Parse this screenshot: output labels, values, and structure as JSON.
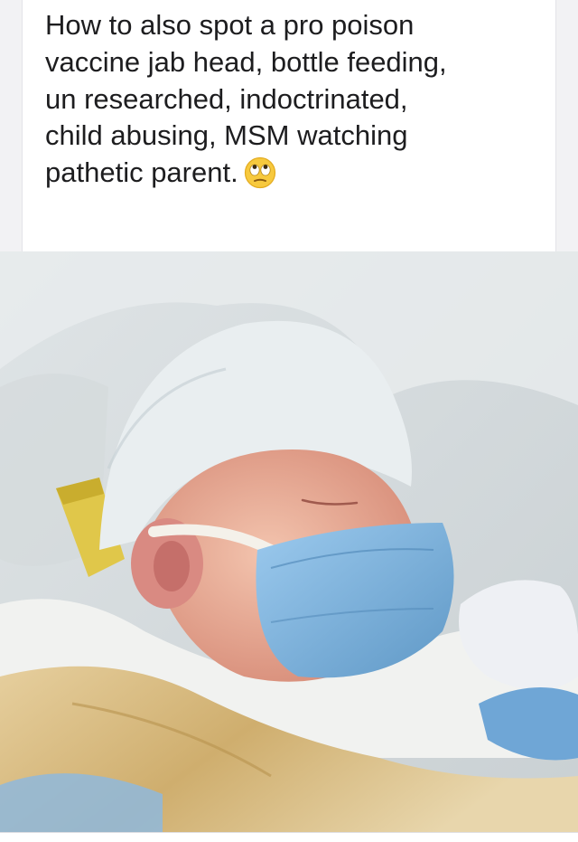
{
  "post": {
    "text": "How to also spot a pro poison\nvaccine jab head, bottle feeding,\nun researched, indoctrinated,\nchild abusing, MSM watching\npathetic parent.",
    "emoji": "face-with-rolling-eyes-icon"
  },
  "photo": {
    "subject": "infant-photo",
    "colors": {
      "mask": "#7fb4dc",
      "hat": "#e9eef0",
      "skin": "#e9b09a",
      "blanket": "#d9c08a"
    }
  }
}
